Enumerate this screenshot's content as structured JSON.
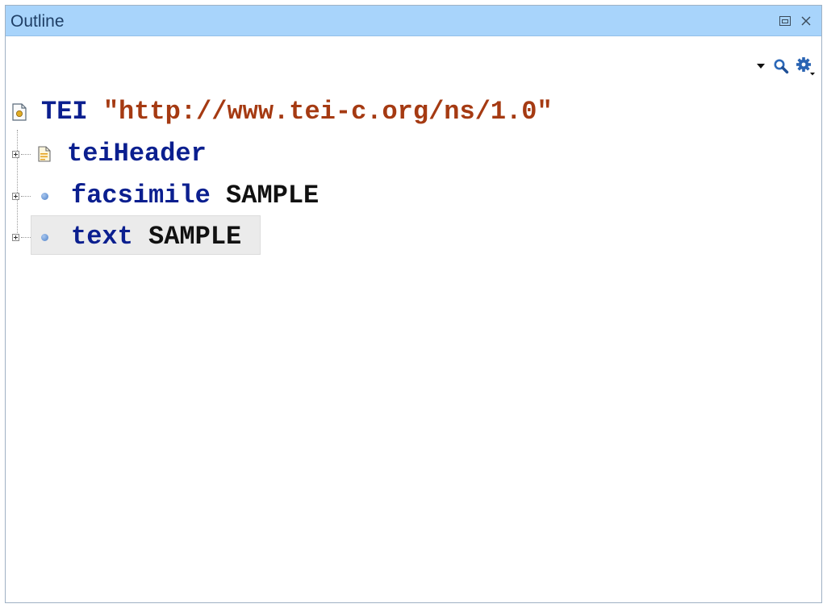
{
  "panel": {
    "title": "Outline"
  },
  "tree": {
    "root": {
      "element": "TEI",
      "namespace": "\"http://www.tei-c.org/ns/1.0\""
    },
    "children": [
      {
        "element": "teiHeader",
        "attribute": ""
      },
      {
        "element": "facsimile",
        "attribute": "SAMPLE"
      },
      {
        "element": "text",
        "attribute": "SAMPLE"
      }
    ]
  },
  "colors": {
    "titlebar": "#a8d4fb",
    "element": "#0b1f8f",
    "namespace": "#a53a12",
    "selection": "#ebebeb"
  },
  "icons": {
    "titlebar": [
      "restore-icon",
      "close-icon"
    ],
    "toolbar": [
      "dropdown-arrow-icon",
      "search-icon",
      "settings-icon"
    ]
  }
}
